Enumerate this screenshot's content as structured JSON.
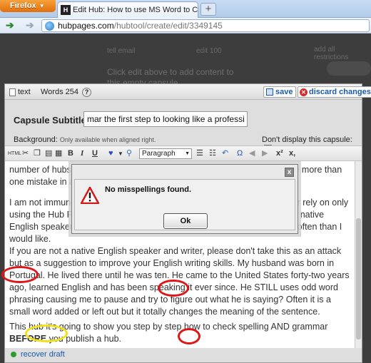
{
  "browser": {
    "menu_button": "Firefox",
    "tab_favicon": "H",
    "tab_title": "Edit Hub: How to use MS Word to Check...",
    "new_tab": "+",
    "url_host": "hubpages.com",
    "url_path": "/hubtool/create/edit/3349145",
    "icons": [
      "firefox-menu-caret-icon",
      "back-arrow-icon",
      "forward-arrow-icon",
      "site-globe-icon"
    ]
  },
  "background_page": {
    "snippet_a": "tell email",
    "snippet_b": "edit 100",
    "snippet_c": "add all restrictions",
    "hint": "Click edit above to add content to this empty capsule."
  },
  "editor": {
    "type_label": "text",
    "word_count": "Words 254",
    "help": "?",
    "save_label": "save",
    "discard_label": "discard changes",
    "subtitle_label": "Capsule Subtitle:",
    "subtitle_value": "mar the first step to looking like a professional.",
    "background_label": "Background:",
    "background_note": "Only available when aligned right.",
    "dont_display_label": "Don't display this capsule:",
    "toolbar": {
      "html": "HTML",
      "bold": "B",
      "italic": "I",
      "underline": "U",
      "paragraph": "Paragraph",
      "omega": "Ω",
      "superscript": "x²",
      "subscript": "x,"
    },
    "paragraphs": {
      "p1": "number of hubs where they are making obvious spelling mistakes. If I see more than one mistake in a hub I skip it and move on to the next one.",
      "p2": "I am not immune to making spelling mistakes myself, which is why I never rely on only using the Hub Pages \"Spell Check\" to catch all errors. Whether you are a native English speaker or not, I am not immune, because I catch them far more often than I would like.",
      "p3": "If you are not a native English speaker and writer, please don't take this as an attack but as a suggestion to improve your English writing skills. My husband was born in Portugal. He lived there until he was ten. He came to the United States forty-two years ago, learned English and has been speaking it ever since. He STILL uses odd word phrasing causing me to pause and try to figure out what he is saying? Often it is a small word added or left out but it totally changes the meaning of the sentence.",
      "p4_start": "This hub it's going to show you step by step how to check spelling AND grammar ",
      "p4_bold": "BEFORE",
      "p4_end": " you publish a hub."
    },
    "recover_draft": "recover draft"
  },
  "dialog": {
    "message": "No misspellings found.",
    "ok_label": "Ok",
    "close": "x",
    "icon": "warning-triangle-icon"
  },
  "annotations": {
    "red": "#e01616",
    "yellow": "#f3e21a"
  }
}
